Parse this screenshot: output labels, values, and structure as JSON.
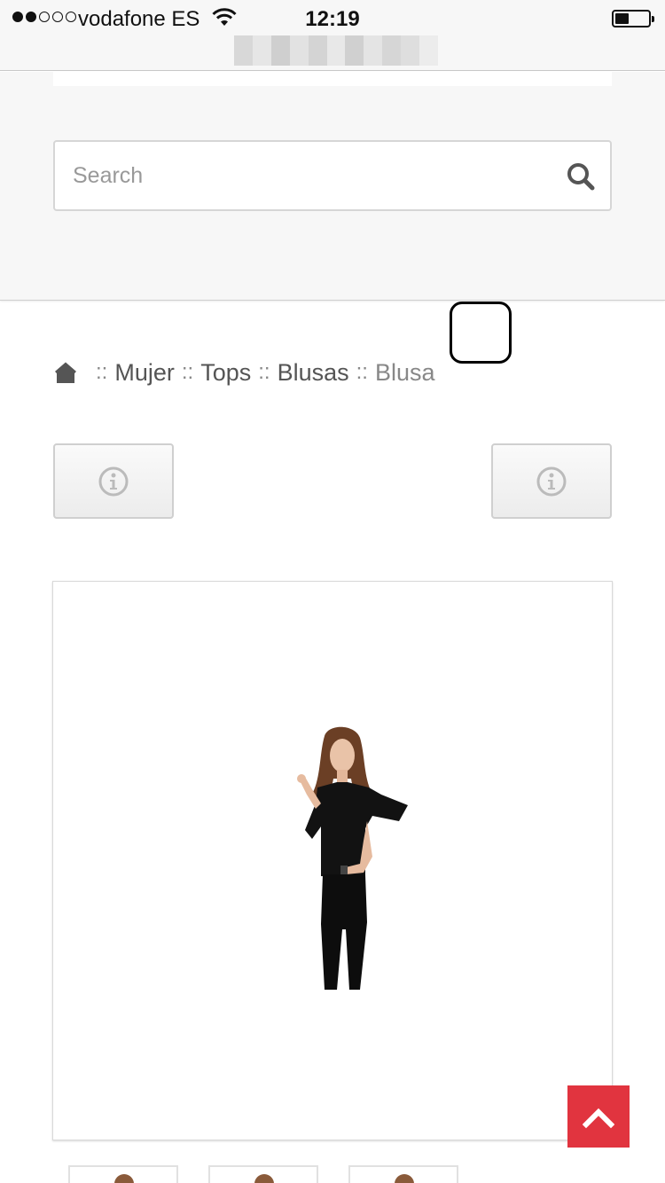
{
  "status_bar": {
    "carrier": "vodafone ES",
    "time": "12:19",
    "signal_bars_filled": 2,
    "signal_bars_total": 5,
    "battery_level": 0.35
  },
  "search": {
    "placeholder": "Search",
    "value": ""
  },
  "breadcrumb": {
    "separator": "::",
    "items": [
      "Mujer",
      "Tops",
      "Blusas"
    ],
    "current": "Blusa"
  },
  "colors": {
    "accent": "#e1343f",
    "breadcrumb_text": "#555555",
    "header_bg": "#f7f7f7"
  },
  "icons": {
    "search": "search-icon",
    "home": "home-icon",
    "info": "info-icon",
    "back_to_top": "chevron-up-icon"
  }
}
